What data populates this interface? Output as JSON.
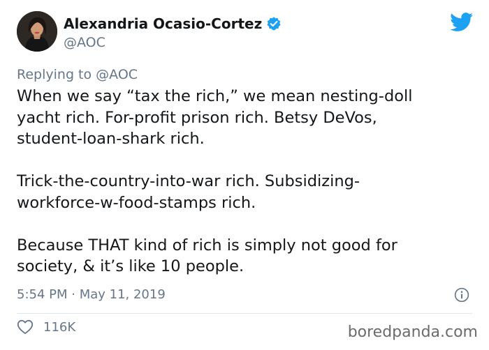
{
  "tweet": {
    "author": {
      "display_name": "Alexandria Ocasio-Cortez",
      "handle": "@AOC",
      "avatar_icon": "profile-photo",
      "verified_icon": "verified-badge-icon",
      "verified_color": "#1da1f2"
    },
    "brand_icon": "twitter-bird-icon",
    "brand_color": "#1da1f2",
    "replying_to": {
      "prefix": "Replying to ",
      "handle": "@AOC"
    },
    "paragraphs": [
      "When we say “tax the rich,” we mean nesting-doll\nyacht rich. For-profit prison rich. Betsy DeVos,\nstudent-loan-shark rich.",
      "Trick-the-country-into-war rich. Subsidizing-\nworkforce-w-food-stamps rich.",
      "Because THAT kind of rich is simply not good for\nsociety, & it’s like 10 people."
    ],
    "timestamp": "5:54 PM · May 11, 2019",
    "info_icon": "info-icon",
    "likes": {
      "icon": "heart-icon",
      "count": "116K"
    }
  },
  "watermark": "boredpanda.com"
}
